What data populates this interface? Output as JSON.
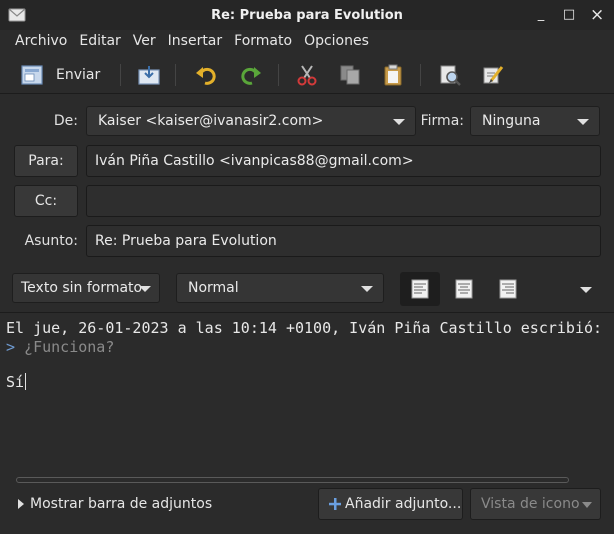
{
  "window": {
    "title": "Re: Prueba para Evolution",
    "minimize": "_",
    "maximize": "□",
    "close": "×"
  },
  "menu": [
    "Archivo",
    "Editar",
    "Ver",
    "Insertar",
    "Formato",
    "Opciones"
  ],
  "toolbar": {
    "send_label": "Enviar",
    "icons": [
      "send-icon",
      "save-draft-icon",
      "undo-icon",
      "redo-icon",
      "cut-icon",
      "copy-icon",
      "paste-icon",
      "find-icon",
      "spellcheck-icon",
      "overflow-arrow-icon"
    ]
  },
  "header": {
    "from_label": "De:",
    "from_value": "Kaiser <kaiser@ivanasir2.com>",
    "signature_label": "Firma:",
    "signature_value": "Ninguna",
    "to_button": "Para:",
    "to_value": "Iván Piña Castillo <ivanpicas88@gmail.com>",
    "cc_button": "Cc:",
    "cc_value": "",
    "subject_label": "Asunto:",
    "subject_value": "Re: Prueba para Evolution"
  },
  "format": {
    "mode": "Texto sin formato",
    "paragraph_style": "Normal",
    "align_icons": [
      "align-left-icon",
      "align-center-icon",
      "align-right-icon"
    ]
  },
  "body": {
    "attribution": "El jue, 26-01-2023 a las 10:14 +0100, Iván Piña Castillo escribió:",
    "quote_mark": ">",
    "quoted_text": "¿Funciona?",
    "reply_text": "Sí"
  },
  "attachments": {
    "toggle_label": "Mostrar barra de adjuntos",
    "add_button": "Añadir adjunto...",
    "view_mode": "Vista de icono"
  }
}
